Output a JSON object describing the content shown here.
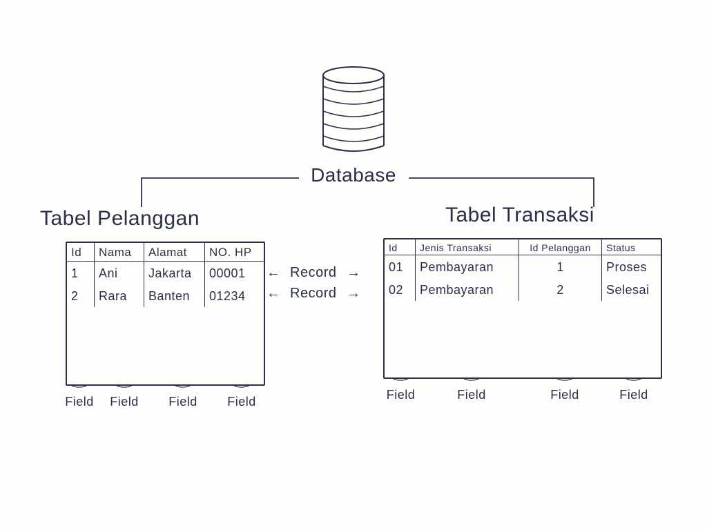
{
  "database": {
    "label": "Database"
  },
  "left_table": {
    "title": "Tabel Pelanggan",
    "columns": [
      "Id",
      "Nama",
      "Alamat",
      "NO. HP"
    ],
    "rows": [
      [
        "1",
        "Ani",
        "Jakarta",
        "00001"
      ],
      [
        "2",
        "Rara",
        "Banten",
        "01234"
      ]
    ]
  },
  "right_table": {
    "title": "Tabel Transaksi",
    "columns": [
      "Id",
      "Jenis Transaksi",
      "Id Pelanggan",
      "Status"
    ],
    "rows": [
      [
        "01",
        "Pembayaran",
        "1",
        "Proses"
      ],
      [
        "02",
        "Pembayaran",
        "2",
        "Selesai"
      ]
    ]
  },
  "annotations": {
    "record": "Record",
    "field": "Field"
  }
}
